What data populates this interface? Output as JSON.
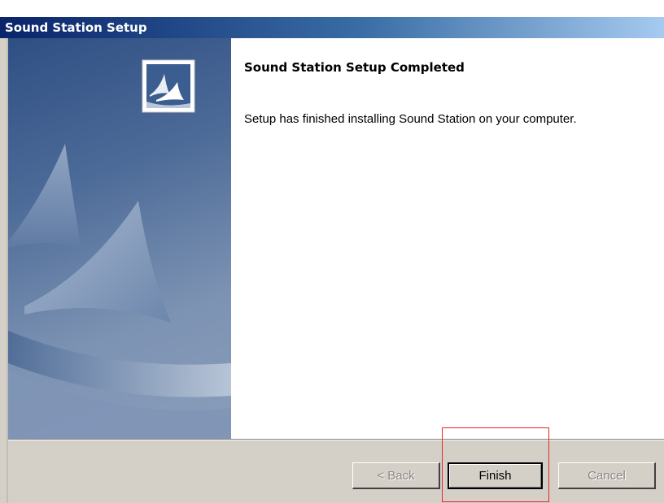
{
  "window": {
    "title": "Sound Station Setup"
  },
  "content": {
    "heading": "Sound Station Setup Completed",
    "message": "Setup has finished installing Sound Station on your computer."
  },
  "buttons": {
    "back": "< Back",
    "finish": "Finish",
    "cancel": "Cancel"
  },
  "colors": {
    "titlebar_start": "#0a246a",
    "titlebar_end": "#a6caf0",
    "highlight": "#e8242a"
  },
  "icons": {
    "setup_logo": "sail-logo-icon"
  }
}
